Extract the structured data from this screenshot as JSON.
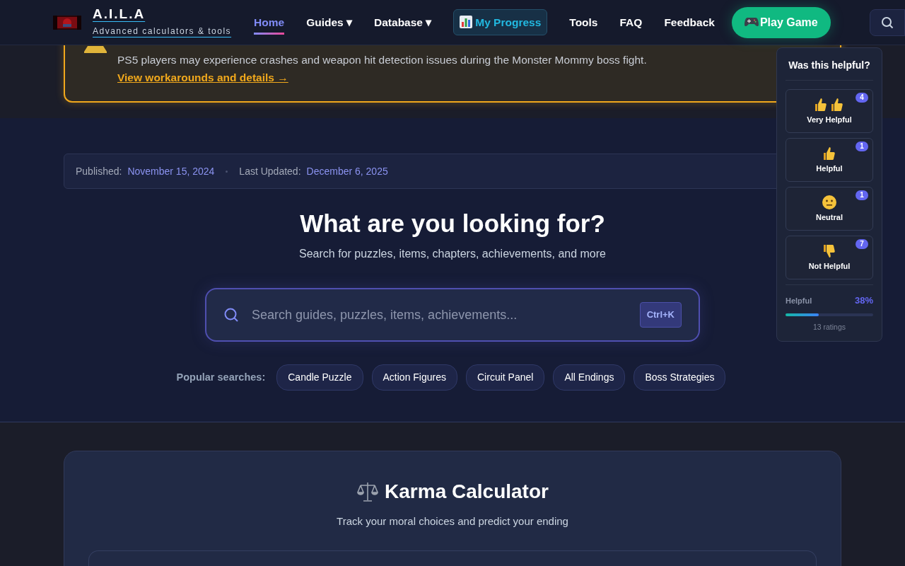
{
  "brand": {
    "title": "A.I.L.A",
    "tagline": "Advanced calculators & tools"
  },
  "nav": [
    {
      "label": "Home",
      "kind": "link",
      "selected": true
    },
    {
      "label": "Guides",
      "kind": "dropdown",
      "caret": "▾",
      "selected": false
    },
    {
      "label": "Database",
      "kind": "dropdown",
      "caret": "▾",
      "selected": false
    },
    {
      "label": "My Progress",
      "kind": "highlight",
      "selected": false
    },
    {
      "label": "Tools",
      "kind": "link",
      "selected": false
    },
    {
      "label": "FAQ",
      "kind": "link",
      "selected": false
    },
    {
      "label": "Feedback",
      "kind": "link",
      "selected": false
    }
  ],
  "play_button": {
    "label": "Play Game"
  },
  "alert": {
    "text": "PS5 players may experience crashes and weapon hit detection issues during the Monster Mommy boss fight.",
    "link": "View workarounds and details →"
  },
  "meta": {
    "published_label": "Published:",
    "published": "November 15, 2024",
    "updated_label": "Last Updated:",
    "updated": "December 6, 2025"
  },
  "hero": {
    "title": "What are you looking for?",
    "subtitle": "Search for puzzles, items, chapters, achievements, and more",
    "search_placeholder": "Search guides, puzzles, items, achievements...",
    "shortcut": "Ctrl+K"
  },
  "popular": {
    "label": "Popular searches:",
    "tags": [
      "Candle Puzzle",
      "Action Figures",
      "Circuit Panel",
      "All Endings",
      "Boss Strategies"
    ]
  },
  "calculator": {
    "title": "Karma Calculator",
    "subtitle": "Track your moral choices and predict your ending"
  },
  "feedback": {
    "title": "Was this helpful?",
    "options": [
      {
        "kind": "very",
        "label": "Very Helpful",
        "count": "4"
      },
      {
        "kind": "helpful",
        "label": "Helpful",
        "count": "1"
      },
      {
        "kind": "neutral",
        "label": "Neutral",
        "count": "1"
      },
      {
        "kind": "not",
        "label": "Not Helpful",
        "count": "7"
      }
    ],
    "stat_label": "Helpful",
    "percent": "38%",
    "level": 0.38,
    "ratings": "13 ratings"
  }
}
